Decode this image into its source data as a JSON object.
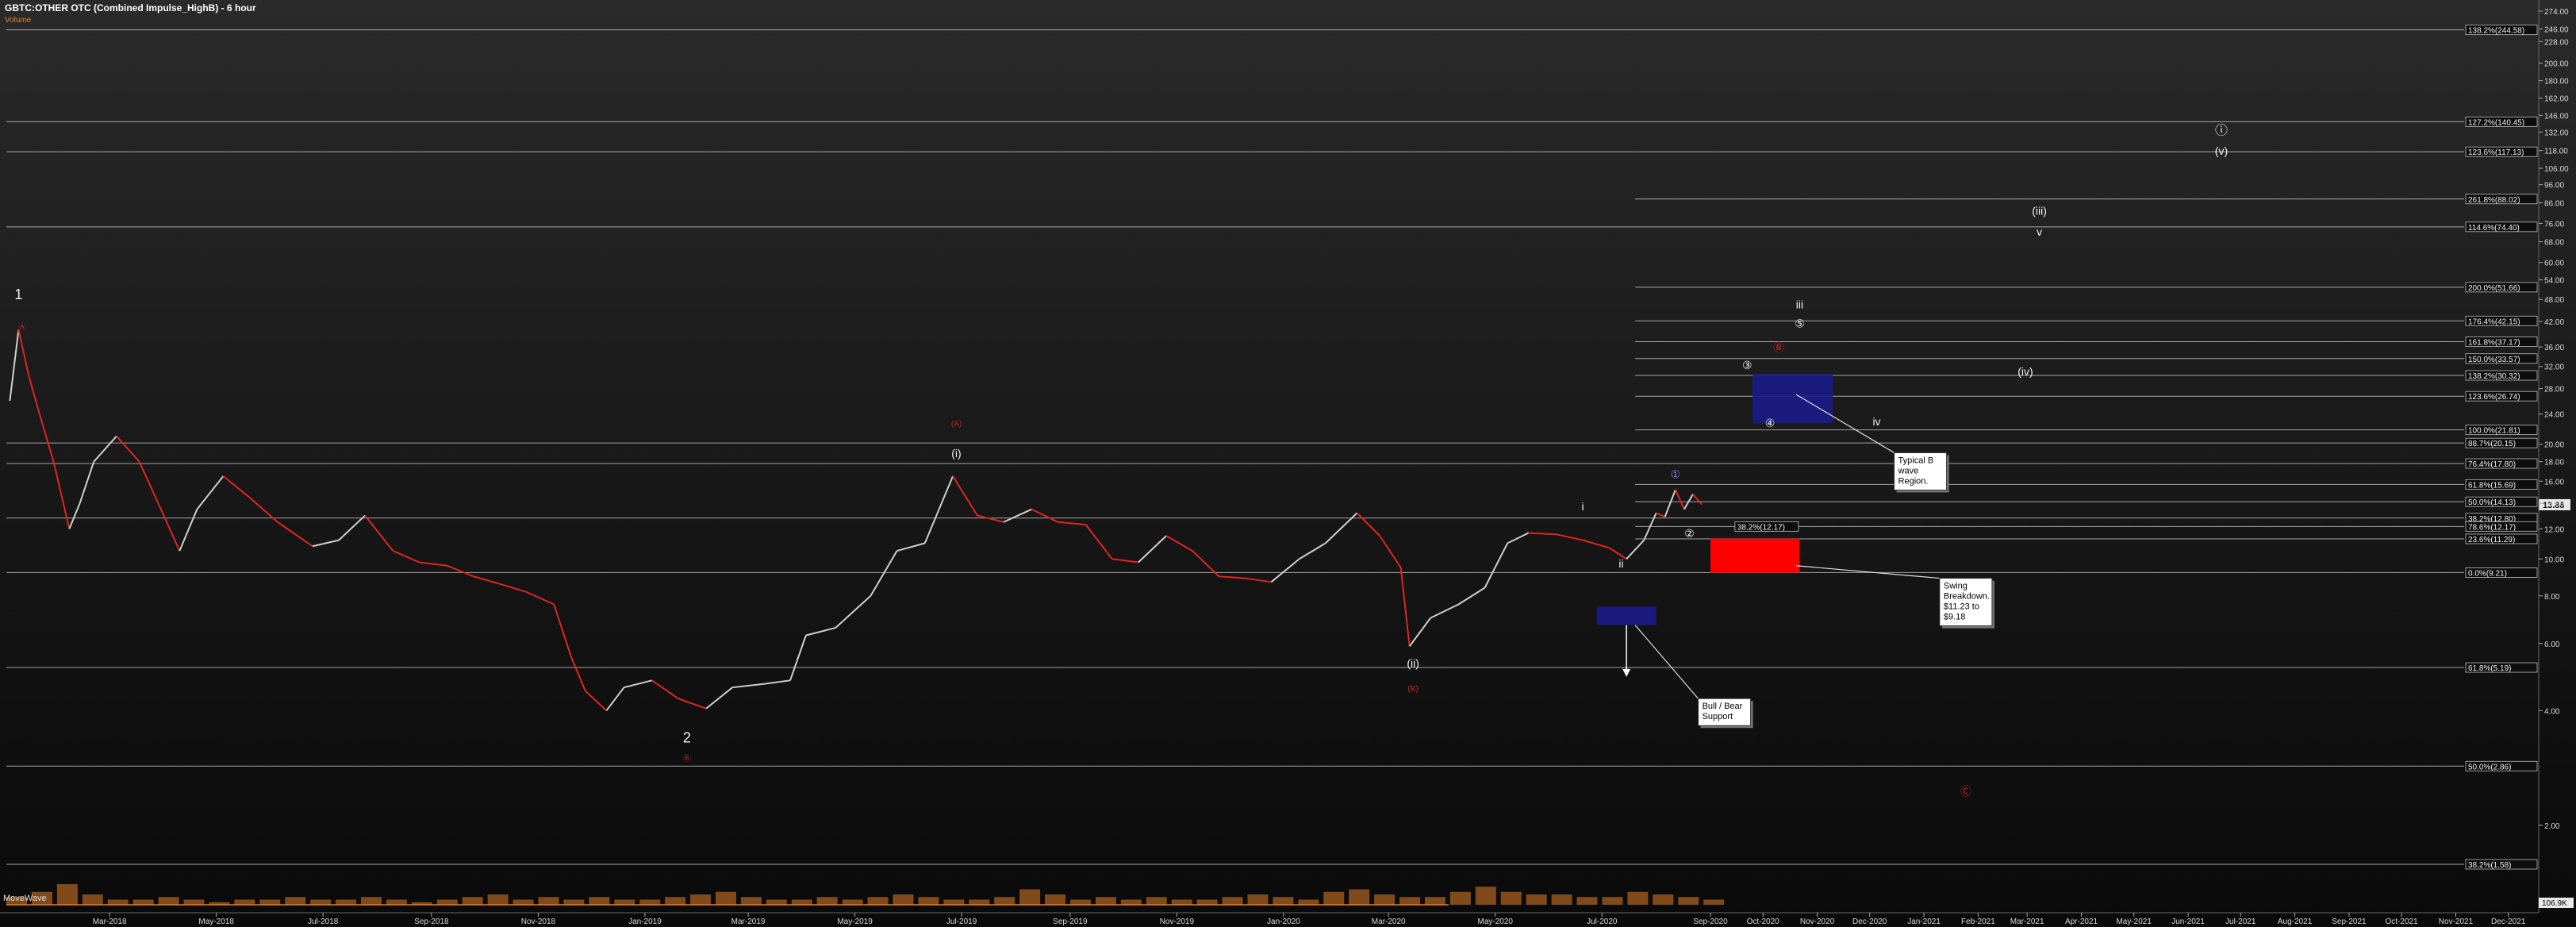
{
  "header": {
    "title": "GBTC:OTHER OTC (Combined Impulse_HighB) - 6 hour",
    "subtitle": "Volume",
    "indicator": "MoveWave"
  },
  "chart_data": {
    "type": "line",
    "title": "GBTC:OTHER OTC (Combined Impulse_HighB) - 6 hour",
    "scale": "log",
    "ylim": [
      1.4,
      280
    ],
    "xlim": [
      "2018-01-01",
      "2021-12-31"
    ],
    "grid": false,
    "colors": {
      "price_up": "#cfcfcf",
      "price_down": "#e02424",
      "box_blue": "#1c1c8a",
      "box_red": "#ff0000",
      "volume": "#e2802a",
      "label_red": "#cc2222"
    },
    "y_ticks": [
      "274.00",
      "246.00",
      "228.00",
      "200.00",
      "180.00",
      "162.00",
      "146.00",
      "132.00",
      "118.00",
      "106.00",
      "96.00",
      "86.00",
      "76.00",
      "68.00",
      "60.00",
      "54.00",
      "48.00",
      "42.00",
      "36.00",
      "32.00",
      "28.00",
      "24.00",
      "20.00",
      "18.00",
      "16.00",
      "14.00",
      "12.00",
      "10.00",
      "8.00",
      "6.00",
      "4.00",
      "2.00"
    ],
    "x_ticks": [
      {
        "label": "Mar-2018",
        "x": "2018-03-01"
      },
      {
        "label": "May-2018",
        "x": "2018-05-01"
      },
      {
        "label": "Jul-2018",
        "x": "2018-07-01"
      },
      {
        "label": "Sep-2018",
        "x": "2018-09-01"
      },
      {
        "label": "Nov-2018",
        "x": "2018-11-01"
      },
      {
        "label": "Jan-2019",
        "x": "2019-01-01"
      },
      {
        "label": "Mar-2019",
        "x": "2019-03-01"
      },
      {
        "label": "May-2019",
        "x": "2019-05-01"
      },
      {
        "label": "Jul-2019",
        "x": "2019-07-01"
      },
      {
        "label": "Sep-2019",
        "x": "2019-09-01"
      },
      {
        "label": "Nov-2019",
        "x": "2019-11-01"
      },
      {
        "label": "Jan-2020",
        "x": "2020-01-01"
      },
      {
        "label": "Mar-2020",
        "x": "2020-03-01"
      },
      {
        "label": "May-2020",
        "x": "2020-05-01"
      },
      {
        "label": "Jul-2020",
        "x": "2020-07-01"
      },
      {
        "label": "Sep-2020",
        "x": "2020-09-01"
      },
      {
        "label": "Oct-2020",
        "x": "2020-10-01"
      },
      {
        "label": "Nov-2020",
        "x": "2020-11-01"
      },
      {
        "label": "Dec-2020",
        "x": "2020-12-01"
      },
      {
        "label": "Jan-2021",
        "x": "2021-01-01"
      },
      {
        "label": "Feb-2021",
        "x": "2021-02-01"
      },
      {
        "label": "Mar-2021",
        "x": "2021-03-01"
      },
      {
        "label": "Apr-2021",
        "x": "2021-04-01"
      },
      {
        "label": "May-2021",
        "x": "2021-05-01"
      },
      {
        "label": "Jun-2021",
        "x": "2021-06-01"
      },
      {
        "label": "Jul-2021",
        "x": "2021-07-01"
      },
      {
        "label": "Aug-2021",
        "x": "2021-08-01"
      },
      {
        "label": "Sep-2021",
        "x": "2021-09-01"
      },
      {
        "label": "Oct-2021",
        "x": "2021-10-01"
      },
      {
        "label": "Nov-2021",
        "x": "2021-11-01"
      },
      {
        "label": "Dec-2021",
        "x": "2021-12-01"
      }
    ],
    "fib_levels": [
      {
        "label": "138.2%(244.58)",
        "value": 244.58,
        "from": "2018-01-01"
      },
      {
        "label": "127.2%(140.45)",
        "value": 140.45,
        "from": "2018-01-01"
      },
      {
        "label": "123.6%(117.13)",
        "value": 117.13,
        "from": "2018-01-01"
      },
      {
        "label": "261.8%(88.02)",
        "value": 88.02,
        "from": "2020-07-20"
      },
      {
        "label": "114.6%(74.40)",
        "value": 74.4,
        "from": "2018-01-01"
      },
      {
        "label": "200.0%(51.66)",
        "value": 51.66,
        "from": "2020-07-20"
      },
      {
        "label": "176.4%(42.15)",
        "value": 42.15,
        "from": "2020-07-20"
      },
      {
        "label": "161.8%(37.17)",
        "value": 37.17,
        "from": "2020-07-20"
      },
      {
        "label": "150.0%(33.57)",
        "value": 33.57,
        "from": "2020-07-20"
      },
      {
        "label": "138.2%(30.32)",
        "value": 30.32,
        "from": "2020-07-20"
      },
      {
        "label": "123.6%(26.74)",
        "value": 26.74,
        "from": "2020-07-20"
      },
      {
        "label": "100.0%(21.81)",
        "value": 21.81,
        "from": "2020-07-20"
      },
      {
        "label": "88.7%(20.15)",
        "value": 20.15,
        "from": "2018-01-01"
      },
      {
        "label": "76.4%(17.80)",
        "value": 17.8,
        "from": "2018-01-01"
      },
      {
        "label": "61.8%(15.69)",
        "value": 15.69,
        "from": "2020-07-20"
      },
      {
        "label": "50.0%(14.13)",
        "value": 14.13,
        "from": "2020-07-20"
      },
      {
        "label": "38.2%(12.80)",
        "value": 12.8,
        "from": "2018-01-01"
      },
      {
        "label": "78.6%(12.17)",
        "value": 12.17,
        "from": "2020-07-20"
      },
      {
        "label": "23.6%(11.29)",
        "value": 11.29,
        "from": "2020-07-20"
      },
      {
        "label": "0.0%(9.21)",
        "value": 9.21,
        "from": "2018-01-01"
      },
      {
        "label": "61.8%(5.19)",
        "value": 5.19,
        "from": "2018-01-01"
      },
      {
        "label": "50.0%(2.86)",
        "value": 2.86,
        "from": "2018-01-01"
      },
      {
        "label": "38.2%(1.58)",
        "value": 1.58,
        "from": "2018-01-01"
      }
    ],
    "extra_level_labels": [
      {
        "label": "38.2%(12.17)",
        "value": 12.17,
        "x": "2020-09-15"
      }
    ],
    "last_price": {
      "label": "13.88",
      "value": 13.88
    },
    "volume_label": "106.9K",
    "price_path": [
      {
        "x": "2018-01-03",
        "y": 26
      },
      {
        "x": "2018-01-08",
        "y": 40
      },
      {
        "x": "2018-01-14",
        "y": 30
      },
      {
        "x": "2018-01-20",
        "y": 24
      },
      {
        "x": "2018-01-28",
        "y": 18
      },
      {
        "x": "2018-02-06",
        "y": 12
      },
      {
        "x": "2018-02-12",
        "y": 14
      },
      {
        "x": "2018-02-20",
        "y": 18
      },
      {
        "x": "2018-03-05",
        "y": 21
      },
      {
        "x": "2018-03-18",
        "y": 18
      },
      {
        "x": "2018-04-01",
        "y": 13
      },
      {
        "x": "2018-04-10",
        "y": 10.5
      },
      {
        "x": "2018-04-20",
        "y": 13.5
      },
      {
        "x": "2018-05-05",
        "y": 16.5
      },
      {
        "x": "2018-05-20",
        "y": 14.5
      },
      {
        "x": "2018-06-05",
        "y": 12.5
      },
      {
        "x": "2018-06-25",
        "y": 10.8
      },
      {
        "x": "2018-07-10",
        "y": 11.2
      },
      {
        "x": "2018-07-25",
        "y": 13
      },
      {
        "x": "2018-08-10",
        "y": 10.5
      },
      {
        "x": "2018-08-25",
        "y": 9.8
      },
      {
        "x": "2018-09-10",
        "y": 9.6
      },
      {
        "x": "2018-09-25",
        "y": 9
      },
      {
        "x": "2018-10-10",
        "y": 8.6
      },
      {
        "x": "2018-10-25",
        "y": 8.2
      },
      {
        "x": "2018-11-10",
        "y": 7.6
      },
      {
        "x": "2018-11-20",
        "y": 5.5
      },
      {
        "x": "2018-11-28",
        "y": 4.5
      },
      {
        "x": "2018-12-10",
        "y": 4.0
      },
      {
        "x": "2018-12-20",
        "y": 4.6
      },
      {
        "x": "2019-01-05",
        "y": 4.8
      },
      {
        "x": "2019-01-20",
        "y": 4.3
      },
      {
        "x": "2019-02-05",
        "y": 4.05
      },
      {
        "x": "2019-02-20",
        "y": 4.6
      },
      {
        "x": "2019-03-10",
        "y": 4.7
      },
      {
        "x": "2019-03-25",
        "y": 4.8
      },
      {
        "x": "2019-04-03",
        "y": 6.3
      },
      {
        "x": "2019-04-20",
        "y": 6.6
      },
      {
        "x": "2019-05-10",
        "y": 8
      },
      {
        "x": "2019-05-25",
        "y": 10.5
      },
      {
        "x": "2019-06-10",
        "y": 11
      },
      {
        "x": "2019-06-26",
        "y": 16.5
      },
      {
        "x": "2019-07-10",
        "y": 13
      },
      {
        "x": "2019-07-25",
        "y": 12.5
      },
      {
        "x": "2019-08-10",
        "y": 13.5
      },
      {
        "x": "2019-08-25",
        "y": 12.5
      },
      {
        "x": "2019-09-10",
        "y": 12.3
      },
      {
        "x": "2019-09-25",
        "y": 10
      },
      {
        "x": "2019-10-10",
        "y": 9.8
      },
      {
        "x": "2019-10-26",
        "y": 11.5
      },
      {
        "x": "2019-11-10",
        "y": 10.5
      },
      {
        "x": "2019-11-25",
        "y": 9
      },
      {
        "x": "2019-12-10",
        "y": 8.9
      },
      {
        "x": "2019-12-25",
        "y": 8.7
      },
      {
        "x": "2020-01-10",
        "y": 10
      },
      {
        "x": "2020-01-25",
        "y": 11
      },
      {
        "x": "2020-02-12",
        "y": 13.2
      },
      {
        "x": "2020-02-25",
        "y": 11.5
      },
      {
        "x": "2020-03-08",
        "y": 9.5
      },
      {
        "x": "2020-03-13",
        "y": 5.9
      },
      {
        "x": "2020-03-25",
        "y": 7
      },
      {
        "x": "2020-04-10",
        "y": 7.6
      },
      {
        "x": "2020-04-25",
        "y": 8.4
      },
      {
        "x": "2020-05-08",
        "y": 11
      },
      {
        "x": "2020-05-20",
        "y": 11.7
      },
      {
        "x": "2020-06-05",
        "y": 11.6
      },
      {
        "x": "2020-06-20",
        "y": 11.2
      },
      {
        "x": "2020-07-05",
        "y": 10.7
      },
      {
        "x": "2020-07-15",
        "y": 10.0
      },
      {
        "x": "2020-07-25",
        "y": 11.2
      },
      {
        "x": "2020-08-01",
        "y": 13.2
      },
      {
        "x": "2020-08-06",
        "y": 12.9
      },
      {
        "x": "2020-08-12",
        "y": 15.2
      },
      {
        "x": "2020-08-17",
        "y": 13.5
      },
      {
        "x": "2020-08-22",
        "y": 14.8
      },
      {
        "x": "2020-08-27",
        "y": 13.9
      }
    ],
    "volume": [
      3,
      5,
      8,
      4,
      2,
      2,
      3,
      2,
      1,
      2,
      2,
      3,
      2,
      2,
      3,
      2,
      1,
      2,
      3,
      4,
      2,
      3,
      2,
      3,
      2,
      2,
      3,
      4,
      5,
      3,
      2,
      2,
      3,
      2,
      3,
      4,
      3,
      2,
      2,
      3,
      6,
      4,
      2,
      3,
      2,
      3,
      2,
      2,
      3,
      4,
      3,
      2,
      5,
      6,
      4,
      3,
      3,
      5,
      7,
      5,
      4,
      4,
      3,
      3,
      5,
      4,
      3,
      2
    ],
    "wave_labels": [
      {
        "text": "1",
        "x": "2018-01-08",
        "y": 48,
        "color": "white",
        "size": 18
      },
      {
        "text": "2",
        "x": "2019-01-25",
        "y": 3.3,
        "color": "white",
        "size": 18
      },
      {
        "text": "(i)",
        "x": "2019-06-28",
        "y": 18.5,
        "color": "white"
      },
      {
        "text": "(ii)",
        "x": "2020-03-15",
        "y": 5.2,
        "color": "white"
      },
      {
        "text": "(iii)",
        "x": "2021-03-08",
        "y": 80,
        "color": "white"
      },
      {
        "text": "(iv)",
        "x": "2021-02-28",
        "y": 30.3,
        "color": "white"
      },
      {
        "text": "(v)",
        "x": "2021-06-20",
        "y": 115,
        "color": "white"
      },
      {
        "text": "i",
        "x": "2020-06-20",
        "y": 13.4,
        "color": "white"
      },
      {
        "text": "ii",
        "x": "2020-07-12",
        "y": 9.5,
        "color": "white"
      },
      {
        "text": "iii",
        "x": "2020-10-22",
        "y": 45.5,
        "color": "white"
      },
      {
        "text": "iv",
        "x": "2020-12-05",
        "y": 22.4,
        "color": "white"
      },
      {
        "text": "v",
        "x": "2021-03-08",
        "y": 70.5,
        "color": "white"
      },
      {
        "text": "(A)",
        "x": "2019-06-28",
        "y": 22.3,
        "color": "red",
        "size": 10
      },
      {
        "text": "(B)",
        "x": "2020-03-15",
        "y": 4.5,
        "color": "red",
        "size": 10
      },
      {
        "text": "ⓘ",
        "x": "2021-06-20",
        "y": 130,
        "color": "white",
        "size": 16
      },
      {
        "text": "①",
        "x": "2020-08-12",
        "y": 16.3,
        "color": "#8080ff"
      },
      {
        "text": "②",
        "x": "2020-08-20",
        "y": 11.4,
        "color": "white"
      },
      {
        "text": "③",
        "x": "2020-09-22",
        "y": 31.5,
        "color": "white"
      },
      {
        "text": "④",
        "x": "2020-10-05",
        "y": 22.2,
        "color": "white"
      },
      {
        "text": "⑤",
        "x": "2020-10-22",
        "y": 40.5,
        "color": "white"
      },
      {
        "text": "Ⓑ",
        "x": "2020-10-10",
        "y": 35,
        "color": "red"
      },
      {
        "text": "Ⓒ",
        "x": "2021-01-25",
        "y": 2.4,
        "color": "red"
      },
      {
        "text": "Ⓐ",
        "x": "2018-01-10",
        "y": 40,
        "color": "red",
        "size": 10
      },
      {
        "text": "Ⓑ",
        "x": "2019-01-25",
        "y": 2.95,
        "color": "red",
        "size": 10
      }
    ],
    "annotations": [
      {
        "lines": [
          "Typical B",
          "wave",
          "Region."
        ],
        "x": "2020-12-15",
        "y": 19,
        "arrow_to": {
          "x": "2020-10-20",
          "y": 27
        }
      },
      {
        "lines": [
          "Swing",
          "Breakdown.",
          "$11.23 to",
          "$9.18"
        ],
        "x": "2021-01-10",
        "y": 8.9,
        "arrow_to": {
          "x": "2020-10-20",
          "y": 9.6
        }
      },
      {
        "lines": [
          "Bull / Bear",
          "Support"
        ],
        "x": "2020-08-25",
        "y": 4.3,
        "arrow_to": {
          "x": "2020-07-20",
          "y": 6.7
        }
      }
    ],
    "boxes": [
      {
        "color": "blue",
        "x0": "2020-09-25",
        "x1": "2020-11-10",
        "y0": 22.7,
        "y1": 30.6
      },
      {
        "color": "red",
        "x0": "2020-09-01",
        "x1": "2020-10-22",
        "y0": 9.2,
        "y1": 11.3
      },
      {
        "color": "blue",
        "x0": "2020-06-28",
        "x1": "2020-08-01",
        "y0": 6.7,
        "y1": 7.5
      }
    ],
    "down_arrow": {
      "x": "2020-07-15",
      "y0": 6.7,
      "y1": 4.95
    }
  }
}
